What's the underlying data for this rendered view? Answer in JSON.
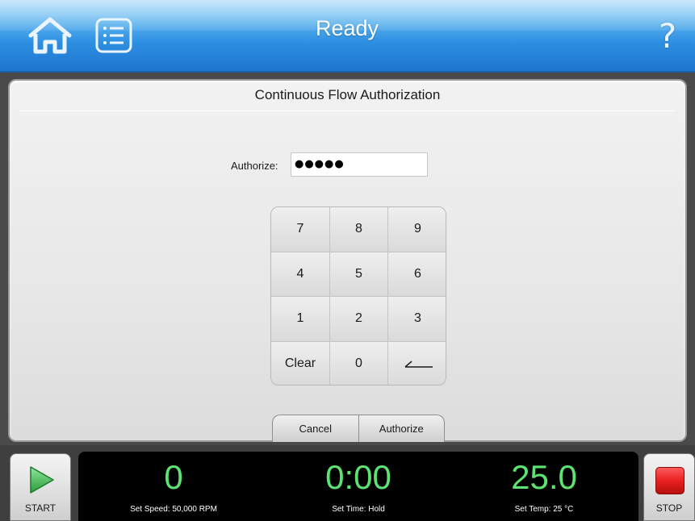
{
  "header": {
    "title": "Ready",
    "help_glyph": "?",
    "accent_color": "#2d8fe2"
  },
  "icons": {
    "home": "home-icon",
    "menu": "list-menu-icon",
    "help": "help-icon",
    "start": "play-triangle-icon",
    "stop": "stop-square-icon",
    "backspace": "backspace-arrow-icon"
  },
  "dialog": {
    "title": "Continuous Flow Authorization",
    "authorize_label": "Authorize:",
    "authorize_value": "●●●●●",
    "keypad": [
      {
        "label": "7"
      },
      {
        "label": "8"
      },
      {
        "label": "9"
      },
      {
        "label": "4"
      },
      {
        "label": "5"
      },
      {
        "label": "6"
      },
      {
        "label": "1"
      },
      {
        "label": "2"
      },
      {
        "label": "3"
      },
      {
        "label": "Clear"
      },
      {
        "label": "0"
      },
      {
        "label": ""
      }
    ],
    "cancel_label": "Cancel",
    "authorize_button_label": "Authorize"
  },
  "status": {
    "start_label": "START",
    "stop_label": "STOP",
    "speed_value": "0",
    "speed_setting": "Set Speed: 50,000 RPM",
    "time_value": "0:00",
    "time_setting": "Set Time: Hold",
    "temp_value": "25.0",
    "temp_setting": "Set Temp: 25 °C",
    "readout_color": "#5de372",
    "stop_color": "#e82020",
    "start_color": "#3bb54a"
  }
}
